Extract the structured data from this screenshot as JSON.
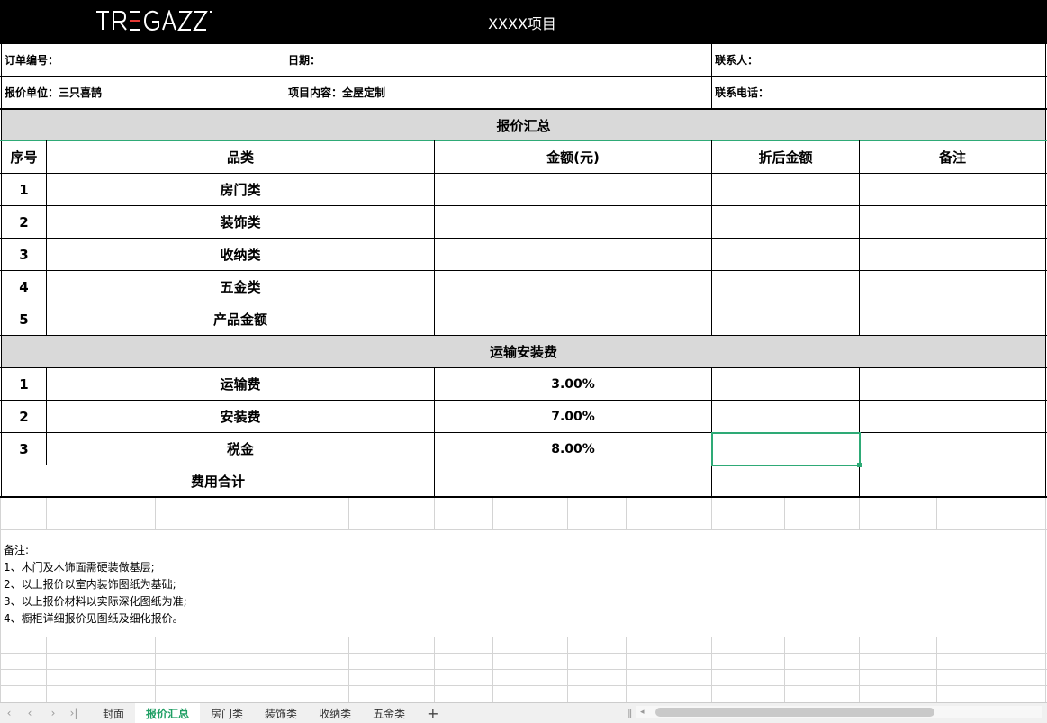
{
  "header": {
    "logo": "TR=GAZZ=",
    "title": "XXXX项目"
  },
  "info": {
    "order_no": "订单编号：",
    "date": "日期：",
    "contact": "联系人：",
    "quote_unit": "报价单位：三只喜鹊",
    "project_content": "项目内容：全屋定制",
    "phone": "联系电话："
  },
  "summary": {
    "section_title": "报价汇总",
    "headers": [
      "序号",
      "品类",
      "金额(元)",
      "折后金额",
      "备注"
    ],
    "rows": [
      {
        "no": "1",
        "category": "房门类"
      },
      {
        "no": "2",
        "category": "装饰类"
      },
      {
        "no": "3",
        "category": "收纳类"
      },
      {
        "no": "4",
        "category": "五金类"
      },
      {
        "no": "5",
        "category": "产品金额"
      }
    ]
  },
  "transport": {
    "section_title": "运输安装费",
    "rows": [
      {
        "no": "1",
        "item": "运输费",
        "rate": "3.00%"
      },
      {
        "no": "2",
        "item": "安装费",
        "rate": "7.00%"
      },
      {
        "no": "3",
        "item": "税金",
        "rate": "8.00%"
      }
    ],
    "total_label": "费用合计"
  },
  "notes": [
    "备注:",
    "1、木门及木饰面需硬装做基层;",
    "2、以上报价以室内装饰图纸为基础;",
    "3、以上报价材料以实际深化图纸为准;",
    "4、橱柜详细报价见图纸及细化报价。"
  ],
  "sheet_tabs": [
    "封面",
    "报价汇总",
    "房门类",
    "装饰类",
    "收纳类",
    "五金类"
  ],
  "active_tab": "报价汇总",
  "icons": {
    "add_sheet": "plus-icon",
    "nav": [
      "prev-first-icon",
      "prev-icon",
      "next-icon",
      "last-icon"
    ]
  },
  "colors": {
    "header_bg": "#000000",
    "section_bg": "#d9d9d9",
    "accent": "#1e9e63"
  }
}
